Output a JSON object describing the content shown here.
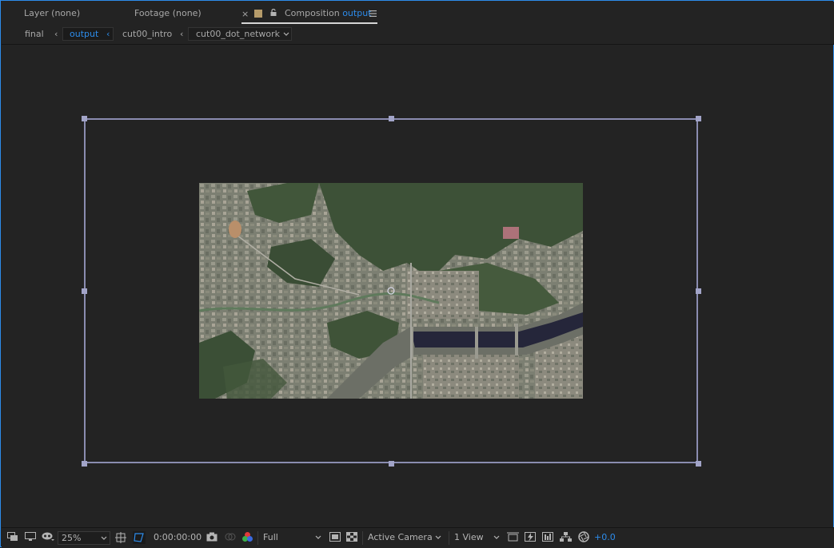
{
  "tabs": {
    "layer": {
      "label": "Layer",
      "value": "(none)"
    },
    "footage": {
      "label": "Footage",
      "value": "(none)"
    },
    "composition": {
      "close": "×",
      "label": "Composition",
      "value": "output"
    }
  },
  "breadcrumbs": {
    "items": [
      "final",
      "output",
      "cut00_intro",
      "cut00_dot_network"
    ],
    "separator": "‹",
    "active": "output"
  },
  "toolbar": {
    "zoom": "25%",
    "timecode": "0:00:00:00",
    "resolution": "Full",
    "camera": "Active Camera",
    "views": "1 View",
    "exposure": "+0.0"
  },
  "colors": {
    "accent": "#2d8ceb",
    "bounds": "#8a8cb0",
    "label_swatch": "#b59b6a",
    "background": "#232323"
  },
  "icons": [
    "lock-icon",
    "panel-menu-icon",
    "snapshot-icon",
    "color-channels-icon",
    "grid-icon",
    "transparency-grid-icon",
    "region-of-interest-icon",
    "fast-preview-icon",
    "timeline-icon",
    "flowchart-icon",
    "exposure-reset-icon"
  ]
}
